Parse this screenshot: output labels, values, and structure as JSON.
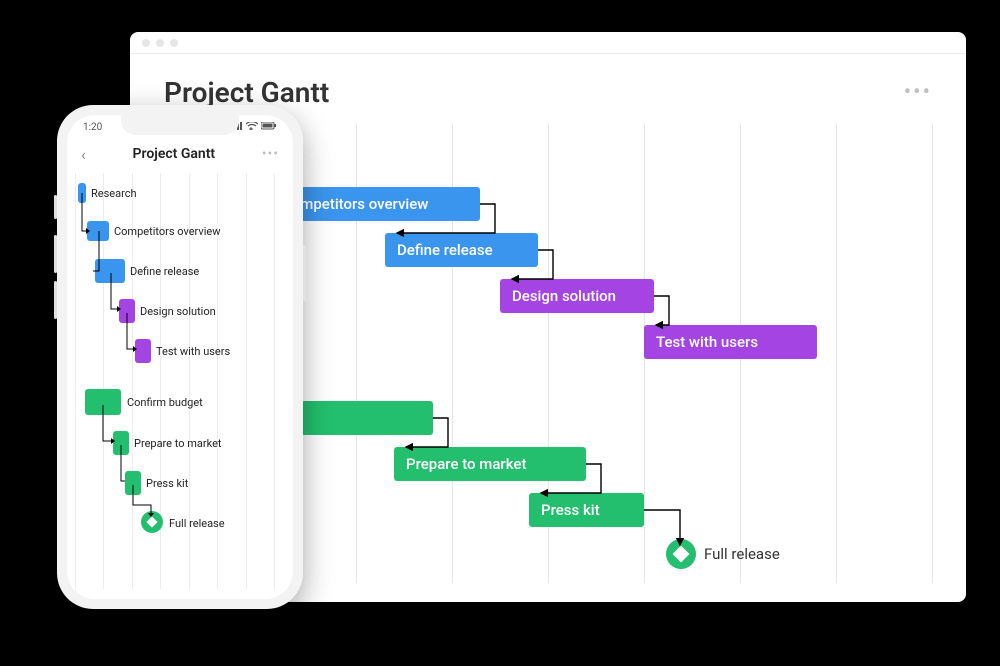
{
  "title": "Project Gantt",
  "phone_time": "1:20",
  "colors": {
    "blue": "#3a95ee",
    "purple": "#a444e3",
    "green": "#23bf6e"
  },
  "tasks": [
    {
      "label": "Research",
      "color": "blue"
    },
    {
      "label": "Competitors overview",
      "color": "blue"
    },
    {
      "label": "Define release",
      "color": "blue"
    },
    {
      "label": "Design solution",
      "color": "purple"
    },
    {
      "label": "Test with users",
      "color": "purple"
    },
    {
      "label": "Confirm budget",
      "color": "green"
    },
    {
      "label": "Prepare to market",
      "color": "green"
    },
    {
      "label": "Press kit",
      "color": "green"
    }
  ],
  "milestone": {
    "label": "Full release"
  },
  "chart_data": {
    "type": "gantt",
    "time_unit": "columns",
    "columns": 8,
    "tasks": [
      {
        "name": "Research",
        "start": 0.1,
        "end": 1.1,
        "group": "plan",
        "depends_on": null,
        "row": 0
      },
      {
        "name": "Competitors overview",
        "start": 1.1,
        "end": 3.3,
        "group": "plan",
        "depends_on": "Research",
        "row": 1
      },
      {
        "name": "Define release",
        "start": 2.3,
        "end": 3.9,
        "group": "plan",
        "depends_on": "Competitors overview",
        "row": 2
      },
      {
        "name": "Design solution",
        "start": 3.5,
        "end": 5.1,
        "group": "design",
        "depends_on": "Define release",
        "row": 3
      },
      {
        "name": "Test with users",
        "start": 5.0,
        "end": 6.8,
        "group": "design",
        "depends_on": "Design solution",
        "row": 4
      },
      {
        "name": "Confirm budget",
        "start": 0.1,
        "end": 2.8,
        "group": "launch",
        "depends_on": null,
        "row": 5
      },
      {
        "name": "Prepare to market",
        "start": 2.4,
        "end": 4.4,
        "group": "launch",
        "depends_on": "Confirm budget",
        "row": 6
      },
      {
        "name": "Press kit",
        "start": 3.8,
        "end": 5.0,
        "group": "launch",
        "depends_on": "Prepare to market",
        "row": 7
      }
    ],
    "milestones": [
      {
        "name": "Full release",
        "at": 5.4,
        "depends_on": "Press kit",
        "row": 8
      }
    ],
    "groups": {
      "plan": {
        "color": "#3a95ee"
      },
      "design": {
        "color": "#a444e3"
      },
      "launch": {
        "color": "#23bf6e"
      }
    }
  }
}
